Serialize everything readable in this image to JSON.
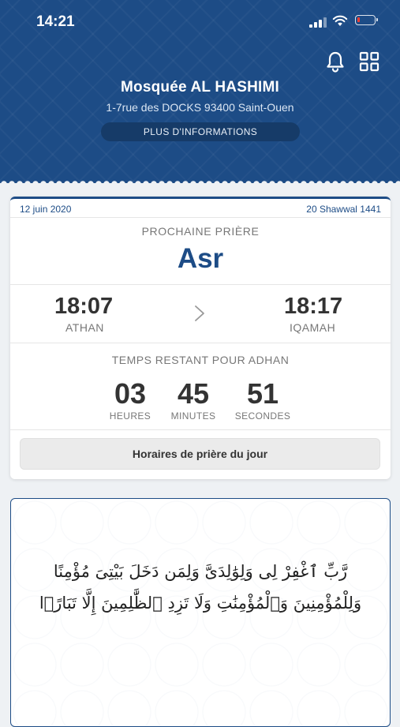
{
  "status_bar": {
    "time": "14:21"
  },
  "header": {
    "mosque_name": "Mosquée AL HASHIMI",
    "address": "1-7rue des DOCKS 93400 Saint-Ouen",
    "more_info_label": "PLUS D'INFORMATIONS"
  },
  "prayer_card": {
    "date_gregorian": "12 juin 2020",
    "date_hijri": "20 Shawwal 1441",
    "next_prayer_label": "PROCHAINE PRIÈRE",
    "next_prayer_name": "Asr",
    "athan_time": "18:07",
    "athan_label": "ATHAN",
    "iqamah_time": "18:17",
    "iqamah_label": "IQAMAH",
    "remaining_label": "TEMPS RESTANT POUR ADHAN",
    "countdown": {
      "hours": "03",
      "hours_label": "HEURES",
      "minutes": "45",
      "minutes_label": "MINUTES",
      "seconds": "51",
      "seconds_label": "SECONDES"
    },
    "daily_times_button": "Horaires de prière du jour"
  },
  "quote_card": {
    "arabic_line1": "رَّبِّ ٱغْفِرْ لِى وَلِوَٰلِدَىَّ وَلِمَن دَخَلَ بَيْتِىَ مُؤْمِنًا",
    "arabic_line2": "وَلِلْمُؤْمِنِينَ وَٱلْمُؤْمِنَٰتِ وَلَا تَزِدِ ٱلظَّٰلِمِينَ إِلَّا تَبَارًۢا"
  },
  "colors": {
    "brand_blue": "#1d4c86",
    "battery_low": "#ff3b30"
  },
  "icons": {
    "notifications": "bell-icon",
    "menu": "grid-icon",
    "next": "chevron-right-icon"
  }
}
